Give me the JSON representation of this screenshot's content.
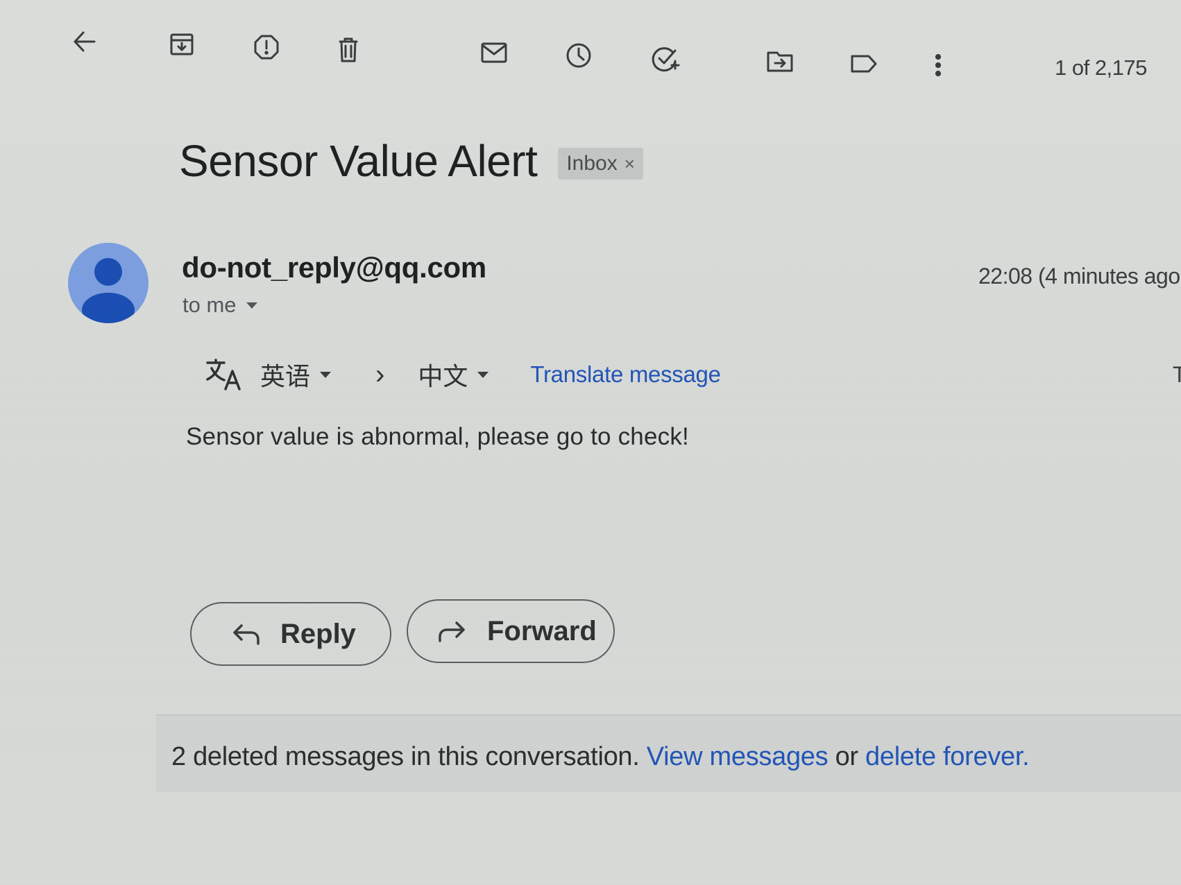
{
  "toolbar": {
    "icons": [
      "back-arrow-icon",
      "archive-icon",
      "report-spam-icon",
      "delete-icon",
      "mark-unread-icon",
      "snooze-icon",
      "add-task-icon",
      "move-to-icon",
      "label-icon",
      "more-vert-icon"
    ],
    "pager": "1 of 2,175"
  },
  "message": {
    "subject": "Sensor Value Alert",
    "label": "Inbox",
    "label_remove": "×",
    "sender": "do-not_reply@qq.com",
    "recipient": "to me",
    "time": "22:08 (4 minutes ago",
    "body": "Sensor value is abnormal, please go to check!"
  },
  "translate": {
    "from_lang": "英语",
    "to_lang": "中文",
    "link": "Translate message",
    "edge_text": "T"
  },
  "actions": {
    "reply": "Reply",
    "forward": "Forward"
  },
  "deleted_notice": {
    "text": "2 deleted messages in this conversation.",
    "view_link": "View messages",
    "or": "or",
    "delete_link": "delete forever."
  },
  "colors": {
    "link": "#2255b8",
    "avatar_bg": "#7d9fe0",
    "avatar_fg": "#1c4fb4",
    "background": "#d9dcd9"
  }
}
